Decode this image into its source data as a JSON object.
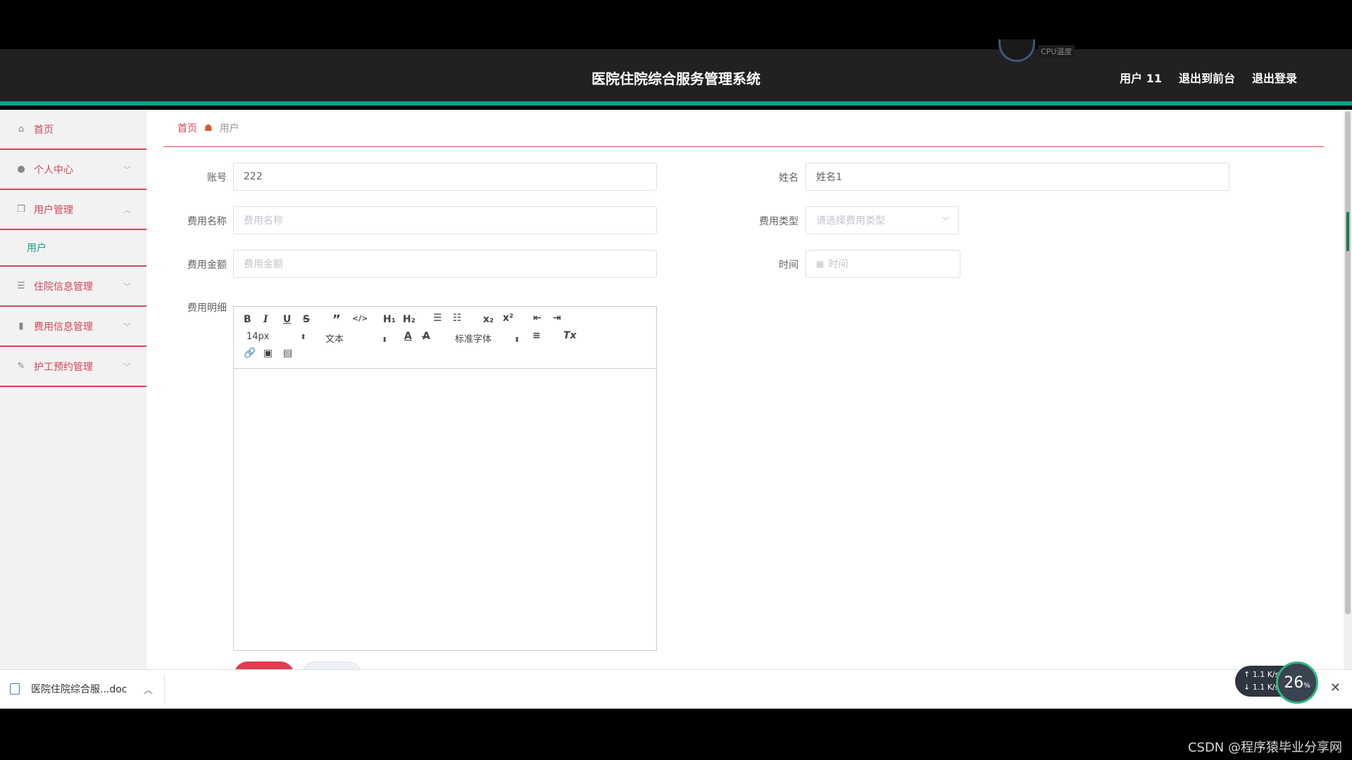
{
  "header": {
    "title": "医院住院综合服务管理系统",
    "cpu_label": "CPU温度",
    "nav": [
      "用户 11",
      "退出到前台",
      "退出登录"
    ]
  },
  "sidebar": {
    "items": [
      {
        "label": "首页",
        "icon": "home-icon",
        "expanded": null
      },
      {
        "label": "个人中心",
        "icon": "user-icon",
        "expanded": false
      },
      {
        "label": "用户管理",
        "icon": "copy-icon",
        "expanded": true
      },
      {
        "label": "住院信息管理",
        "icon": "list-icon",
        "expanded": false
      },
      {
        "label": "费用信息管理",
        "icon": "chart-icon",
        "expanded": false
      },
      {
        "label": "护工预约管理",
        "icon": "pen-icon",
        "expanded": false
      }
    ],
    "subitem": "用户"
  },
  "breadcrumb": {
    "home": "首页",
    "current": "用户"
  },
  "form": {
    "account_label": "账号",
    "account_value": "222",
    "name_label": "姓名",
    "name_value": "姓名1",
    "fee_name_label": "费用名称",
    "fee_name_placeholder": "费用名称",
    "fee_type_label": "费用类型",
    "fee_type_placeholder": "请选择费用类型",
    "fee_amount_label": "费用金额",
    "fee_amount_placeholder": "费用金额",
    "time_label": "时间",
    "time_placeholder": "时间",
    "detail_label": "费用明细"
  },
  "editor": {
    "font_size": "14px",
    "paragraph": "文本",
    "font_family": "标准字体"
  },
  "download": {
    "filename": "医院住院综合服...doc"
  },
  "net": {
    "up": "1.1",
    "down": "1.1",
    "unit": "K/s",
    "gauge": "26",
    "gauge_unit": "%"
  },
  "watermark": "CSDN @程序猿毕业分享网",
  "colors": {
    "accent_red": "#d54459",
    "accent_teal": "#129d8a",
    "header_bg": "#212121"
  }
}
